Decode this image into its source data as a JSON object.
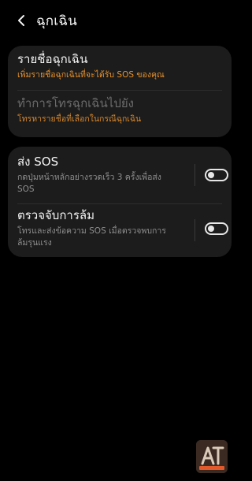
{
  "header": {
    "back_icon": "back-chevron-icon",
    "title": "ฉุกเฉิน"
  },
  "emergency_contacts": {
    "title": "รายชื่อฉุกเฉิน",
    "subtitle": "เพิ่มรายชื่อฉุกเฉินที่จะได้รับ SOS ของคุณ"
  },
  "emergency_call": {
    "title": "ทำการโทรฉุกเฉินไปยัง",
    "subtitle": "โทรหารายชื่อที่เลือกในกรณีฉุกเฉิน"
  },
  "send_sos": {
    "title": "ส่ง SOS",
    "subtitle": "กดปุ่มหน้าหลักอย่างรวดเร็ว 3 ครั้งเพื่อส่ง SOS",
    "enabled": false
  },
  "fall_detection": {
    "title": "ตรวจจับการล้ม",
    "subtitle": "โทรและส่งข้อความ SOS เมื่อตรวจพบการล้มรุนแรง",
    "enabled": false
  },
  "colors": {
    "background": "#000000",
    "card": "#1c1c1c",
    "accent_orange": "#e8912a",
    "disabled_text": "#6c6c6c",
    "secondary_text": "#8f8f8f"
  }
}
